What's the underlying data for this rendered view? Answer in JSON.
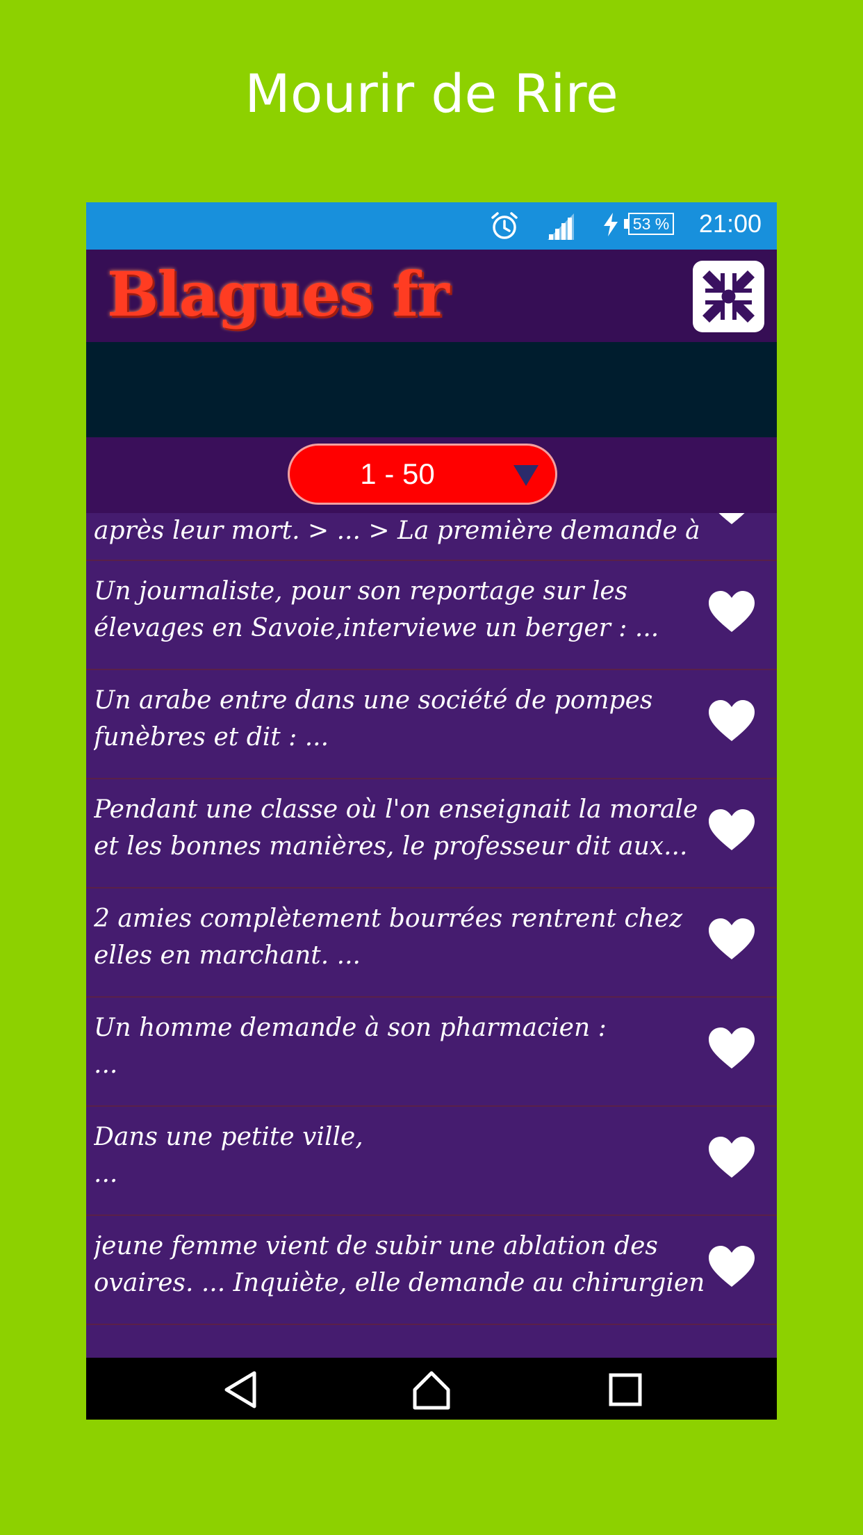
{
  "promo": {
    "title": "Mourir de Rire"
  },
  "status_bar": {
    "time": "21:00",
    "battery": "53 %"
  },
  "app_bar": {
    "logo_text": "Blagues fr"
  },
  "range": {
    "selected": "1 - 50"
  },
  "jokes": [
    "après leur mort. > ... > La première demande à l'",
    "Un journaliste, pour son reportage sur les élevages en Savoie,interviewe un berger : ...",
    "Un arabe entre dans une société de pompes funèbres et dit : ...",
    "Pendant une classe où l'on enseignait la morale et les bonnes manières, le professeur dit aux...",
    "2 amies complètement bourrées rentrent chez elles en marchant. ...",
    "Un homme demande à son pharmacien :\n...",
    "Dans une petite ville,\n...",
    "jeune femme vient de subir une ablation des ovaires. ... Inquiète, elle demande au chirurgien"
  ]
}
